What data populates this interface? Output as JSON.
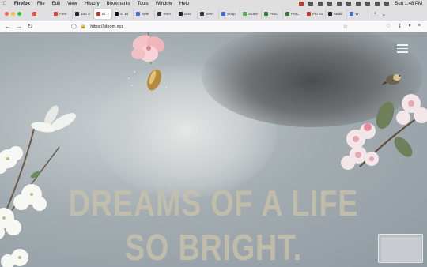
{
  "menubar": {
    "app": "Firefox",
    "items": [
      "File",
      "Edit",
      "View",
      "History",
      "Bookmarks",
      "Tools",
      "Window",
      "Help"
    ],
    "clock": "Sun 1:48 PM"
  },
  "tabs": [
    {
      "label": "",
      "color": "#e8542e"
    },
    {
      "label": "Fore",
      "color": "#d44638"
    },
    {
      "label": "100 S",
      "color": "#222222"
    },
    {
      "label": "Bl",
      "color": "#c0392b",
      "active": true
    },
    {
      "label": "X: El",
      "color": "#111111"
    },
    {
      "label": "Sele",
      "color": "#3b6fd8"
    },
    {
      "label": "Teen",
      "color": "#333333"
    },
    {
      "label": "Disc",
      "color": "#222222"
    },
    {
      "label": "Teen",
      "color": "#333333"
    },
    {
      "label": "Shop",
      "color": "#3b6fd8"
    },
    {
      "label": "Stude",
      "color": "#4caf50"
    },
    {
      "label": "PMC",
      "color": "#2e7d32"
    },
    {
      "label": "PMC",
      "color": "#2e7d32"
    },
    {
      "label": "Pip Ev",
      "color": "#c0392b"
    },
    {
      "label": "Mobil",
      "color": "#222222"
    },
    {
      "label": "W",
      "color": "#3b6fd8"
    }
  ],
  "nav": {
    "url": "https://bloom.xyz"
  },
  "site": {
    "headline_line1": "DREAMS OF A LIFE",
    "headline_line2": "SO BRIGHT."
  }
}
